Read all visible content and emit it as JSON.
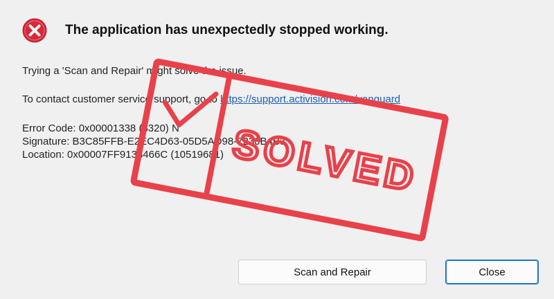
{
  "dialog": {
    "title": "The application has unexpectedly stopped working.",
    "icon": "error-icon",
    "accent_color": "#d8283a"
  },
  "message": {
    "line1": "Trying a 'Scan and Repair' might solve the issue.",
    "contact_prefix": "To contact customer service support, go to ",
    "contact_link": "https://support.activision.com/vanguard",
    "error_code": "Error Code: 0x00001338 (8320) N",
    "signature": "Signature: B3C85FFB-E2EC4D63-05D5AD98-7230B4B3",
    "location": "Location: 0x00007FF9138466C (10519681)"
  },
  "buttons": {
    "scan_repair": "Scan and Repair",
    "close": "Close"
  },
  "stamp": {
    "text": "SOLVED",
    "color": "#e9414a"
  }
}
